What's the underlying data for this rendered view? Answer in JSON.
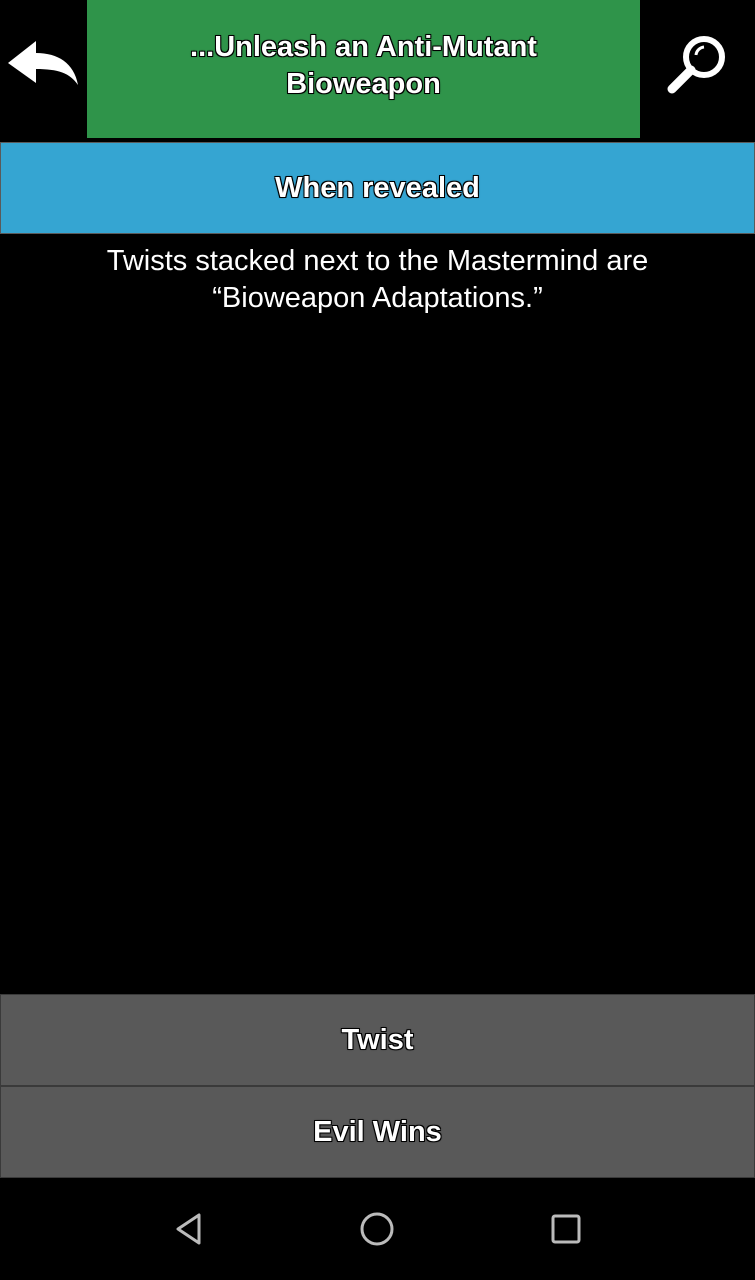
{
  "header": {
    "title": "...Unleash an Anti-Mutant Bioweapon",
    "back_icon": "back-arrow-icon",
    "search_icon": "search-icon",
    "title_bg_color": "#2f944a"
  },
  "section": {
    "label": "When revealed",
    "bg_color": "#35a5d2",
    "text": "Twists stacked next to the Mastermind are “Bioweapon Adaptations.”"
  },
  "buttons": {
    "twist": "Twist",
    "evil_wins": "Evil Wins",
    "bg_color": "#595959"
  },
  "navbar": {
    "back_icon": "nav-back-icon",
    "home_icon": "nav-home-icon",
    "recents_icon": "nav-recents-icon"
  }
}
